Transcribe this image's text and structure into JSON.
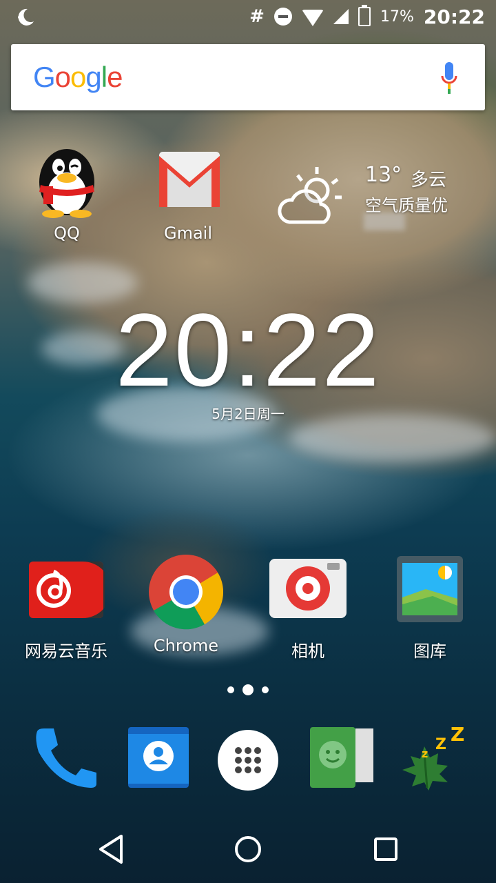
{
  "status_bar": {
    "left_icon": "night-mode-icon",
    "battery_percent": "17%",
    "time": "20:22",
    "icons": [
      "hash-icon",
      "do-not-disturb-icon",
      "wifi-icon",
      "cell-signal-icon",
      "battery-icon"
    ]
  },
  "search": {
    "logo_letters": [
      "G",
      "o",
      "o",
      "g",
      "l",
      "e"
    ],
    "mic_icon": "mic-icon"
  },
  "home_apps_top": [
    {
      "label": "QQ",
      "icon": "qq-penguin-icon"
    },
    {
      "label": "Gmail",
      "icon": "gmail-icon"
    }
  ],
  "weather": {
    "temperature": "13°",
    "condition": "多云",
    "air_quality": "空气质量优",
    "icon": "partly-cloudy-icon"
  },
  "clock_widget": {
    "time": "20:22",
    "date": "5月2日周一"
  },
  "home_apps_bottom": [
    {
      "label": "网易云音乐",
      "icon": "netease-music-icon"
    },
    {
      "label": "Chrome",
      "icon": "chrome-icon"
    },
    {
      "label": "相机",
      "icon": "camera-icon"
    },
    {
      "label": "图库",
      "icon": "gallery-icon"
    }
  ],
  "dock": [
    {
      "name": "phone",
      "icon": "phone-icon"
    },
    {
      "name": "contacts",
      "icon": "contacts-icon"
    },
    {
      "name": "app-drawer",
      "icon": "app-drawer-icon"
    },
    {
      "name": "messaging",
      "icon": "messaging-icon"
    },
    {
      "name": "sleep",
      "icon": "sleep-leaf-icon"
    }
  ],
  "nav": {
    "back": "back-icon",
    "home": "home-icon",
    "recents": "recents-icon"
  },
  "colors": {
    "gmail_red": "#EA4335",
    "netease_red": "#E0201B",
    "phone_blue": "#2196F3",
    "contacts_blue": "#1E88E5",
    "messaging_green": "#43A047",
    "camera_red": "#E53935"
  }
}
